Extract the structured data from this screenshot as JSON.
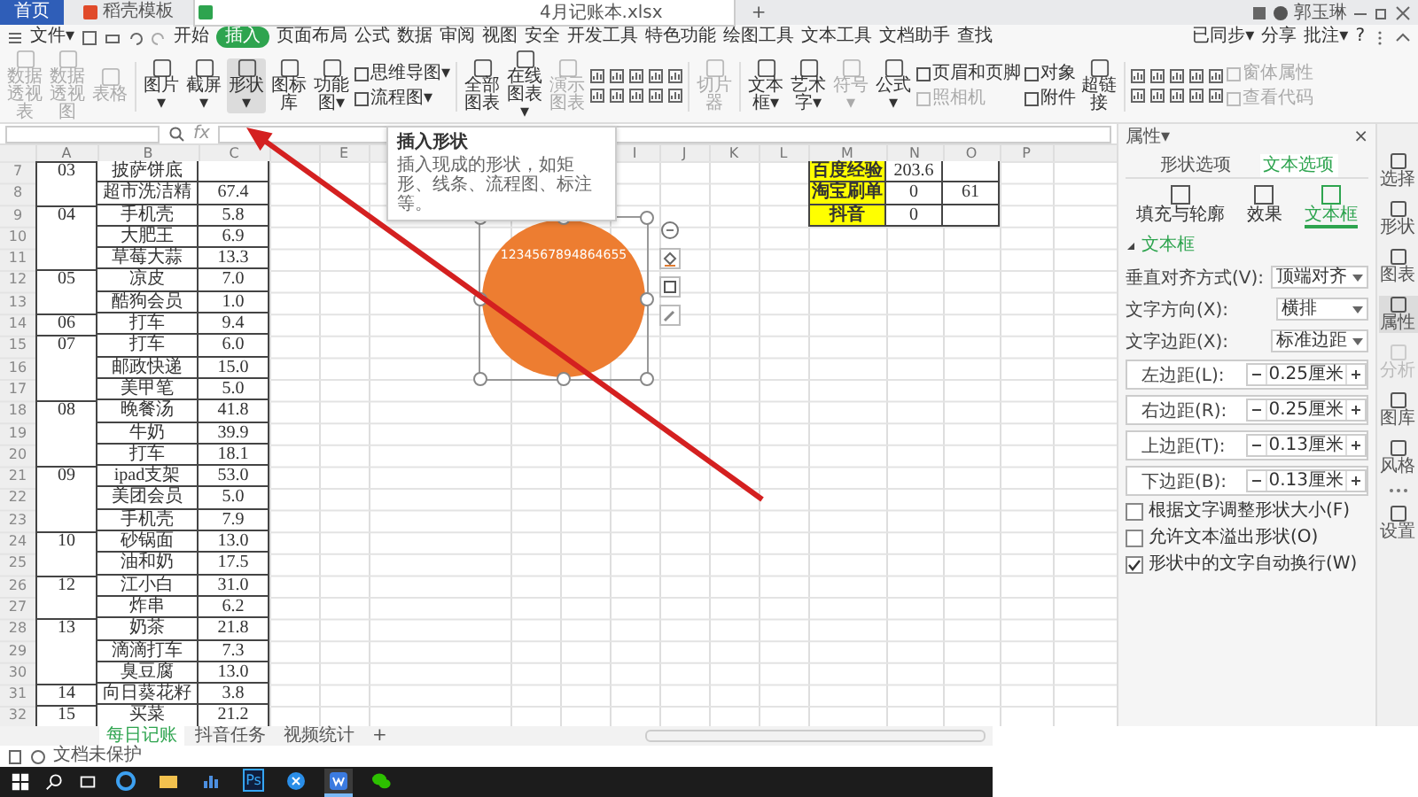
{
  "tabbar": {
    "tabs": [
      {
        "label": "首页",
        "kind": "home",
        "selected": false
      },
      {
        "label": "稻壳模板",
        "kind": "template",
        "selected": false
      },
      {
        "label": "4月记账本.xlsx",
        "kind": "sheet",
        "selected": true
      }
    ],
    "new_tab": "+",
    "user": "郭玉琳"
  },
  "menu": {
    "file": "文件▾",
    "items": [
      {
        "label": "开始",
        "selected": false
      },
      {
        "label": "插入",
        "selected": true
      },
      {
        "label": "页面布局",
        "selected": false
      },
      {
        "label": "公式",
        "selected": false
      },
      {
        "label": "数据",
        "selected": false
      },
      {
        "label": "审阅",
        "selected": false
      },
      {
        "label": "视图",
        "selected": false
      },
      {
        "label": "安全",
        "selected": false
      },
      {
        "label": "开发工具",
        "selected": false
      },
      {
        "label": "特色功能",
        "selected": false
      },
      {
        "label": "绘图工具",
        "selected": false
      },
      {
        "label": "文本工具",
        "selected": false
      },
      {
        "label": "文档助手",
        "selected": false
      }
    ],
    "search": "查找",
    "actions": [
      "已同步▾",
      "分享",
      "批注▾"
    ],
    "help": "?"
  },
  "ribbon": [
    {
      "kind": "big",
      "label": "数据透视表",
      "disabled": true,
      "selected": false
    },
    {
      "kind": "big",
      "label": "数据透视图",
      "disabled": true,
      "selected": false
    },
    {
      "kind": "big",
      "label": "表格",
      "disabled": true,
      "selected": false
    },
    {
      "kind": "sep"
    },
    {
      "kind": "big",
      "label": "图片▾",
      "disabled": false,
      "selected": false
    },
    {
      "kind": "big",
      "label": "截屏▾",
      "disabled": false,
      "selected": false
    },
    {
      "kind": "big",
      "label": "形状▾",
      "disabled": false,
      "selected": true
    },
    {
      "kind": "big",
      "label": "图标库",
      "disabled": false,
      "selected": false
    },
    {
      "kind": "big",
      "label": "功能图▾",
      "disabled": false,
      "selected": false
    },
    {
      "kind": "pair",
      "items": [
        {
          "label": "思维导图▾",
          "disabled": false
        },
        {
          "label": "流程图▾",
          "disabled": false
        }
      ]
    },
    {
      "kind": "sep"
    },
    {
      "kind": "big",
      "label": "全部图表",
      "disabled": false,
      "selected": false
    },
    {
      "kind": "big",
      "label": "在线图表▾",
      "disabled": false,
      "selected": false
    },
    {
      "kind": "big",
      "label": "演示图表",
      "disabled": true,
      "selected": false
    },
    {
      "kind": "icons",
      "disabled": false
    },
    {
      "kind": "sep"
    },
    {
      "kind": "big",
      "label": "切片器",
      "disabled": true,
      "selected": false
    },
    {
      "kind": "sep"
    },
    {
      "kind": "big",
      "label": "文本框▾",
      "disabled": false,
      "selected": false
    },
    {
      "kind": "big",
      "label": "艺术字▾",
      "disabled": false,
      "selected": false
    },
    {
      "kind": "big",
      "label": "符号▾",
      "disabled": true,
      "selected": false
    },
    {
      "kind": "big",
      "label": "公式▾",
      "disabled": false,
      "selected": false
    },
    {
      "kind": "pair",
      "items": [
        {
          "label": "页眉和页脚",
          "disabled": false
        },
        {
          "label": "照相机",
          "disabled": true
        }
      ]
    },
    {
      "kind": "pair",
      "items": [
        {
          "label": "对象",
          "disabled": false
        },
        {
          "label": "附件",
          "disabled": false
        }
      ]
    },
    {
      "kind": "big",
      "label": "超链接",
      "disabled": false,
      "selected": false
    },
    {
      "kind": "sep"
    },
    {
      "kind": "icons",
      "disabled": false
    },
    {
      "kind": "pair",
      "items": [
        {
          "label": "窗体属性",
          "disabled": true
        },
        {
          "label": "查看代码",
          "disabled": true
        }
      ]
    }
  ],
  "tooltip": {
    "title": "插入形状",
    "text": "插入现成的形状，如矩形、线条、流程图、标注等。"
  },
  "formula_bar": {
    "fx": "fx"
  },
  "sheet": {
    "columns_left": [
      "A",
      "B",
      "C"
    ],
    "columns_middle": [
      "E"
    ],
    "columns_right": [
      "I",
      "J",
      "K",
      "L",
      "M",
      "N",
      "O",
      "P"
    ],
    "rows": [
      {
        "number": "7",
        "a": "03",
        "b": "披萨饼底",
        "m": "百度经验",
        "n": "203.6"
      },
      {
        "number": "8",
        "b": "超市洗洁精",
        "c": "67.4",
        "m": "淘宝刷单",
        "n": "0",
        "o": "61"
      },
      {
        "number": "9",
        "a": "04",
        "b": "手机壳",
        "c": "5.8",
        "m": "抖音",
        "n": "0"
      },
      {
        "number": "10",
        "b": "大肥王",
        "c": "6.9"
      },
      {
        "number": "11",
        "b": "草莓大蒜",
        "c": "13.3"
      },
      {
        "number": "12",
        "a": "05",
        "b": "凉皮",
        "c": "7.0"
      },
      {
        "number": "13",
        "b": "酷狗会员",
        "c": "1.0"
      },
      {
        "number": "14",
        "a": "06",
        "b": "打车",
        "c": "9.4"
      },
      {
        "number": "15",
        "a": "07",
        "b": "打车",
        "c": "6.0"
      },
      {
        "number": "16",
        "b": "邮政快递",
        "c": "15.0"
      },
      {
        "number": "17",
        "b": "美甲笔",
        "c": "5.0"
      },
      {
        "number": "18",
        "a": "08",
        "b": "晚餐汤",
        "c": "41.8"
      },
      {
        "number": "19",
        "b": "牛奶",
        "c": "39.9"
      },
      {
        "number": "20",
        "b": "打车",
        "c": "18.1"
      },
      {
        "number": "21",
        "a": "09",
        "b": "ipad支架",
        "c": "53.0"
      },
      {
        "number": "22",
        "b": "美团会员",
        "c": "5.0"
      },
      {
        "number": "23",
        "b": "手机壳",
        "c": "7.9"
      },
      {
        "number": "24",
        "a": "10",
        "b": "砂锅面",
        "c": "13.0"
      },
      {
        "number": "25",
        "b": "油和奶",
        "c": "17.5"
      },
      {
        "number": "26",
        "a": "12",
        "b": "江小白",
        "c": "31.0"
      },
      {
        "number": "27",
        "b": "炸串",
        "c": "6.2"
      },
      {
        "number": "28",
        "a": "13",
        "b": "奶茶",
        "c": "21.8"
      },
      {
        "number": "29",
        "b": "滴滴打车",
        "c": "7.3"
      },
      {
        "number": "30",
        "b": "臭豆腐",
        "c": "13.0"
      },
      {
        "number": "31",
        "a": "14",
        "b": "向日葵花籽",
        "c": "3.8"
      },
      {
        "number": "32",
        "a": "15",
        "b": "买菜",
        "c": "21.2"
      }
    ],
    "shape": {
      "text": "1234567894864655"
    }
  },
  "panel": {
    "title": "属性▾",
    "close": "×",
    "tabs": [
      {
        "label": "形状选项",
        "selected": false
      },
      {
        "label": "文本选项",
        "selected": true
      }
    ],
    "subtabs": [
      {
        "label": "填充与轮廓",
        "selected": false
      },
      {
        "label": "效果",
        "selected": false
      },
      {
        "label": "文本框",
        "selected": true
      }
    ],
    "section": {
      "label": "文本框",
      "expanded": true
    },
    "fields": [
      {
        "kind": "select",
        "label": "垂直对齐方式(V):",
        "value": "顶端对齐"
      },
      {
        "kind": "select",
        "label": "文字方向(X):",
        "value": "横排"
      },
      {
        "kind": "select",
        "label": "文字边距(X):",
        "value": "标准边距"
      },
      {
        "kind": "spin",
        "label": "左边距(L):",
        "value": "0.25厘米"
      },
      {
        "kind": "spin",
        "label": "右边距(R):",
        "value": "0.25厘米"
      },
      {
        "kind": "spin",
        "label": "上边距(T):",
        "value": "0.13厘米"
      },
      {
        "kind": "spin",
        "label": "下边距(B):",
        "value": "0.13厘米"
      }
    ],
    "checks": [
      {
        "label": "根据文字调整形状大小(F)",
        "checked": false
      },
      {
        "label": "允许文本溢出形状(O)",
        "checked": false
      },
      {
        "label": "形状中的文字自动换行(W)",
        "checked": true
      }
    ]
  },
  "sidebar": [
    {
      "label": "选择",
      "selected": false,
      "disabled": false
    },
    {
      "label": "形状",
      "selected": false,
      "disabled": false
    },
    {
      "label": "图表",
      "selected": false,
      "disabled": false
    },
    {
      "label": "属性",
      "selected": true,
      "disabled": false
    },
    {
      "label": "分析",
      "selected": false,
      "disabled": true
    },
    {
      "label": "图库",
      "selected": false,
      "disabled": false
    },
    {
      "label": "风格",
      "selected": false,
      "disabled": false
    },
    {
      "label": "设置",
      "selected": false,
      "disabled": false
    }
  ],
  "sheet_tabs": {
    "tabs": [
      {
        "label": "每日记账",
        "selected": true
      },
      {
        "label": "抖音任务",
        "selected": false
      },
      {
        "label": "视频统计",
        "selected": false
      }
    ],
    "add": "+"
  },
  "status": {
    "text": "文档未保护"
  },
  "taskbar": {
    "apps": [
      {
        "kind": "browser",
        "active": false
      },
      {
        "kind": "folder",
        "active": false
      },
      {
        "kind": "chart",
        "active": false
      },
      {
        "kind": "ps",
        "label": "Ps",
        "active": false
      },
      {
        "kind": "ring",
        "active": false
      },
      {
        "kind": "wps",
        "active": true
      },
      {
        "kind": "chat",
        "active": false
      }
    ]
  }
}
